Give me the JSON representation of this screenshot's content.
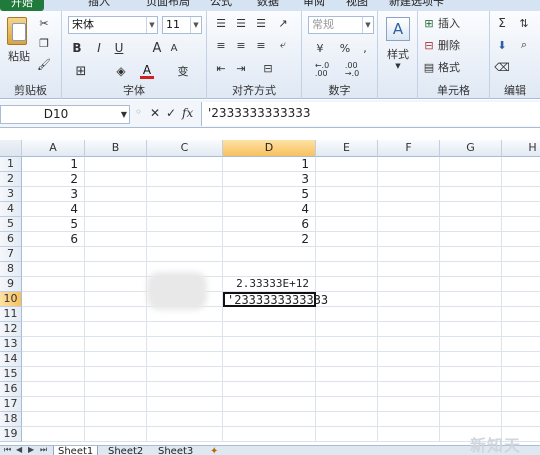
{
  "ribbon_tabs": {
    "file": "开始",
    "insert": "插入",
    "layout": "页面布局",
    "formulas": "公式",
    "data": "数据",
    "review": "审阅",
    "view": "视图",
    "custom": "新建选项卡"
  },
  "clipboard": {
    "paste": "粘贴",
    "label": "剪贴板"
  },
  "font": {
    "name": "宋体",
    "size": "11",
    "bold": "B",
    "italic": "I",
    "underline": "U",
    "label": "字体",
    "grow": "A",
    "shrink": "A",
    "font_color_glyph": "A",
    "phonetic": "变"
  },
  "alignment": {
    "label": "对齐方式"
  },
  "number": {
    "format": "常规",
    "percent": "%",
    "comma": ",",
    "label": "数字",
    "increase_decimal": "←.0\n.00",
    "decrease_decimal": ".00\n→.0"
  },
  "styles": {
    "label": "样式",
    "glyph": "A"
  },
  "cells": {
    "insert": "插入",
    "delete": "删除",
    "format": "格式",
    "label": "单元格"
  },
  "editing": {
    "label": "编辑"
  },
  "formula_bar": {
    "name_box": "D10",
    "content": "'2333333333333"
  },
  "columns": [
    "A",
    "B",
    "C",
    "D",
    "E",
    "F",
    "G",
    "H"
  ],
  "rows": [
    "1",
    "2",
    "3",
    "4",
    "5",
    "6",
    "7",
    "8",
    "9",
    "10",
    "11",
    "12",
    "13",
    "14",
    "15",
    "16",
    "17",
    "18",
    "19"
  ],
  "cells_data": {
    "A": [
      "1",
      "2",
      "3",
      "4",
      "5",
      "6"
    ],
    "D": [
      "1",
      "3",
      "5",
      "4",
      "6",
      "2"
    ],
    "D9": "2.33333E+12",
    "D10": "'2333333333333"
  },
  "sheets": [
    "Sheet1",
    "Sheet2",
    "Sheet3"
  ],
  "watermark": "新知天"
}
